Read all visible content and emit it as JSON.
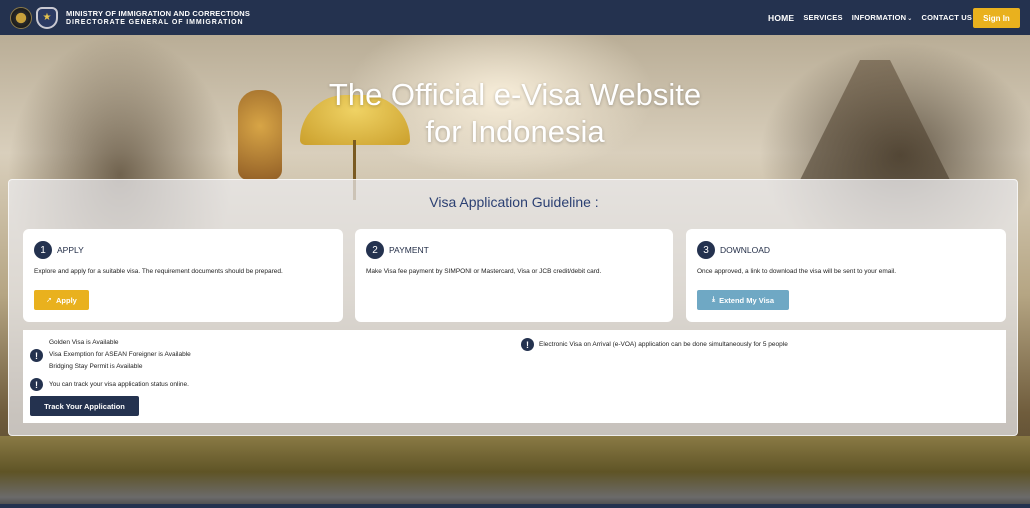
{
  "header": {
    "ministry_line1": "MINISTRY OF IMMIGRATION AND CORRECTIONS",
    "ministry_line2": "DIRECTORATE GENERAL OF IMMIGRATION",
    "nav": [
      {
        "label": "HOME",
        "active": true
      },
      {
        "label": "SERVICES"
      },
      {
        "label": "INFORMATION",
        "has_dropdown": true
      },
      {
        "label": "CONTACT US"
      }
    ],
    "signin_label": "Sign In"
  },
  "hero": {
    "title_line1": "The Official e-Visa Website",
    "title_line2": "for Indonesia"
  },
  "guideline": {
    "title": "Visa Application Guideline :",
    "steps": [
      {
        "number": "1",
        "title": "APPLY",
        "desc": "Explore and apply for a suitable visa. The requirement documents should be prepared.",
        "button": "Apply",
        "button_icon": "send-icon"
      },
      {
        "number": "2",
        "title": "PAYMENT",
        "desc": "Make Visa fee payment by SIMPONI or Mastercard, Visa or JCB credit/debit card."
      },
      {
        "number": "3",
        "title": "DOWNLOAD",
        "desc": "Once approved, a link to download the visa will be sent to your email.",
        "button": "Extend My Visa",
        "button_icon": "download-icon"
      }
    ]
  },
  "notices": {
    "left": [
      "Golden Visa is Available",
      "Visa Exemption for ASEAN Foreigner is Available",
      "Bridging Stay Permit is Available"
    ],
    "track_note": "You can track your visa application status online.",
    "track_button": "Track Your Application",
    "right": "Electronic Visa on Arrival (e-VOA) application can be done simultaneously for 5 people"
  },
  "colors": {
    "navy": "#24324f",
    "gold": "#e9b11e",
    "teal": "#6fa8c4"
  }
}
